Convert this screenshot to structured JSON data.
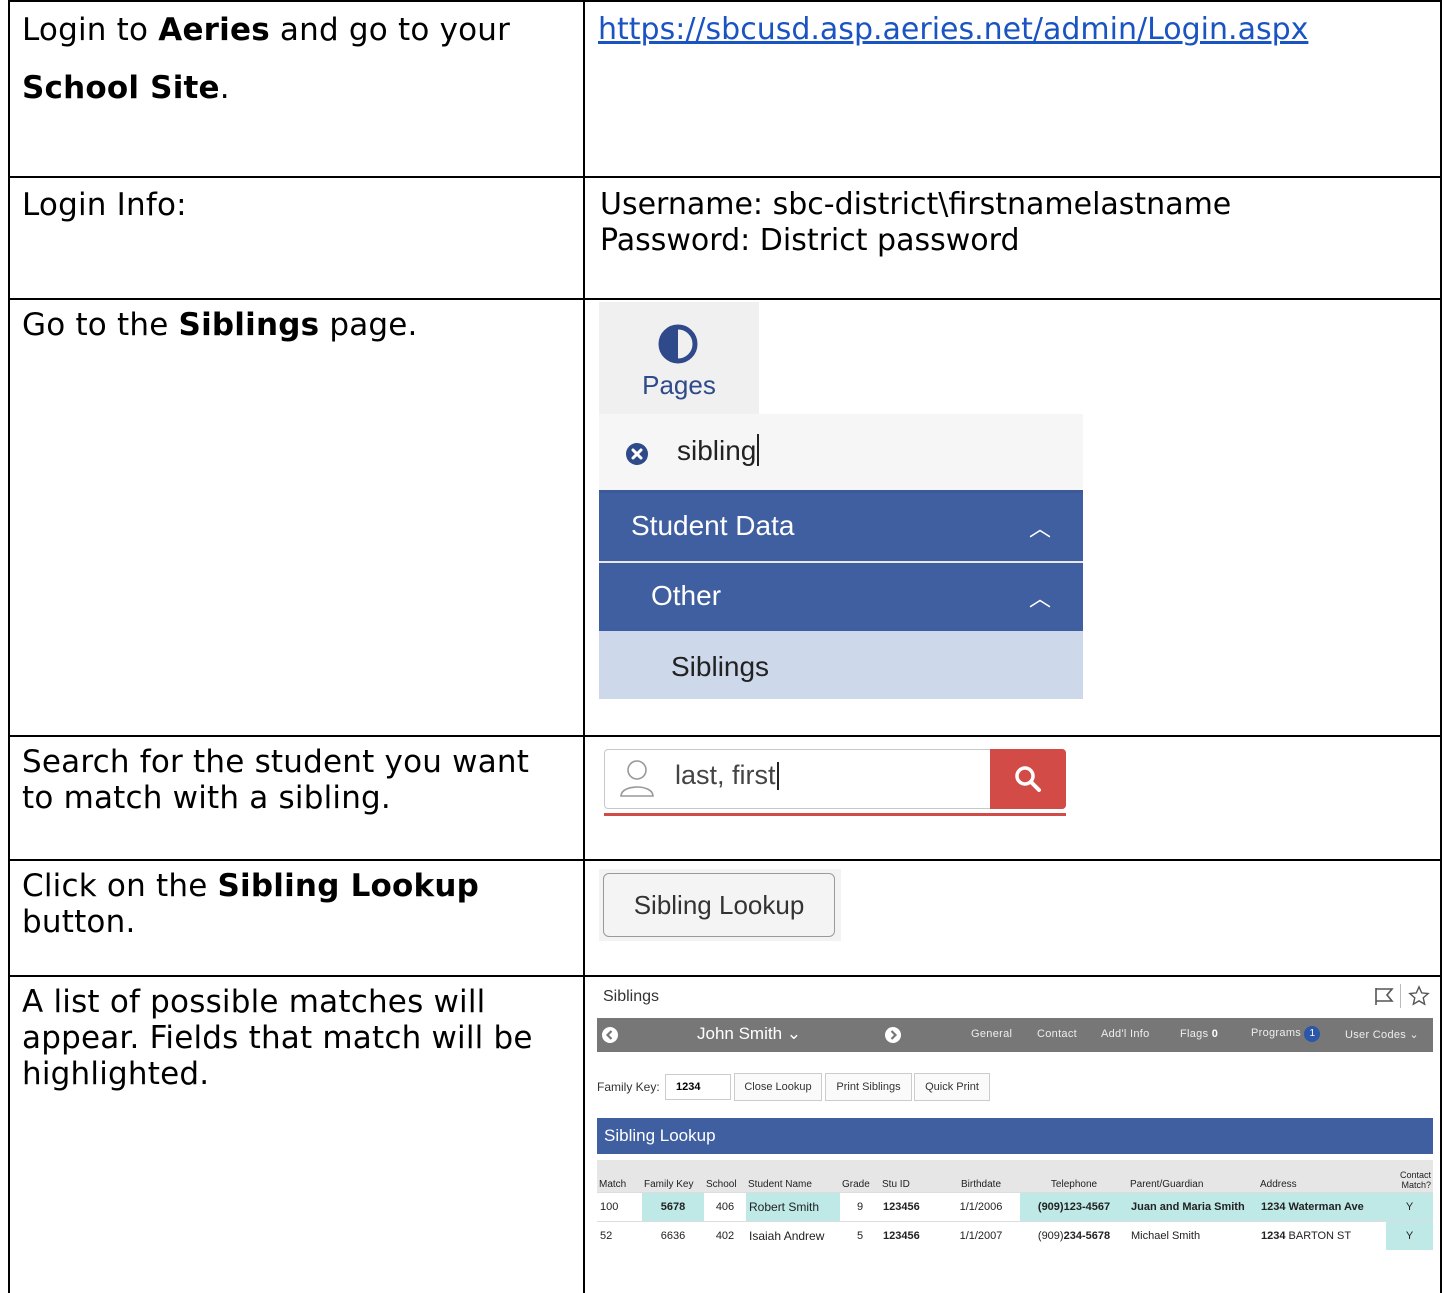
{
  "rows": [
    {
      "left_parts": [
        {
          "t": "Login to ",
          "b": false
        },
        {
          "t": "Aeries",
          "b": true
        },
        {
          "t": " and go to your",
          "b": false
        }
      ],
      "left_parts2": [
        {
          "t": "School Site",
          "b": true
        },
        {
          "t": ".",
          "b": false
        }
      ],
      "link": "https://sbcusd.asp.aeries.net/admin/Login.aspx"
    },
    {
      "left": "Login Info:",
      "login_lines": [
        "Username: sbc-district\\firstnamelastname",
        "Password: District password"
      ]
    },
    {
      "left_parts": [
        {
          "t": "Go to the ",
          "b": false
        },
        {
          "t": "Siblings",
          "b": true
        },
        {
          "t": " page.",
          "b": false
        }
      ]
    },
    {
      "left_line1": "Search for the student you want",
      "left_line2": "to match with a sibling."
    },
    {
      "left_parts": [
        {
          "t": "Click on the ",
          "b": false
        },
        {
          "t": "Sibling Lookup",
          "b": true
        }
      ],
      "left_line2": "button."
    },
    {
      "left_line1": "A list of possible matches will",
      "left_line2": "appear. Fields that match will be",
      "left_line3": "highlighted."
    }
  ],
  "pages_menu": {
    "button_label": "Pages",
    "search_value": "sibling",
    "section": "Student Data",
    "subsection": "Other",
    "item": "Siblings"
  },
  "student_search": {
    "placeholder": "last, first"
  },
  "sibling_button": {
    "label": "Sibling Lookup"
  },
  "siblings_page": {
    "title": "Siblings",
    "student_name": "John Smith ⌄",
    "nav_links": [
      "General",
      "Contact",
      "Add'l Info",
      "Flags",
      "Programs",
      "User Codes ⌄"
    ],
    "flags_count": "0",
    "programs_count": "1",
    "family_key_label": "Family Key:",
    "family_key_value": "1234",
    "buttons": [
      "Close Lookup",
      "Print Siblings",
      "Quick Print"
    ],
    "section_title": "Sibling Lookup",
    "columns": [
      "Match",
      "Family Key",
      "School",
      "Student Name",
      "Grade",
      "Stu ID",
      "Birthdate",
      "Telephone",
      "Parent/Guardian",
      "Address",
      "Contact Match?"
    ],
    "table_rows": [
      {
        "match": "100",
        "family_key": "5678",
        "school": "406",
        "name": "Robert Smith",
        "grade": "9",
        "stu_id": "123456",
        "birthdate": "1/1/2006",
        "phone_prefix": "(909)",
        "phone_rest": "123-4567",
        "parent": "Juan and Maria Smith",
        "address_bold": "1234 Waterman Ave",
        "address_rest": "",
        "contact": "Y"
      },
      {
        "match": "52",
        "family_key": "6636",
        "school": "402",
        "name": "Isaiah Andrew",
        "grade": "5",
        "stu_id": "123456",
        "birthdate": "1/1/2007",
        "phone_prefix": "(909)",
        "phone_rest": "234-5678",
        "parent": "Michael Smith",
        "address_bold": "1234",
        "address_rest": " BARTON ST",
        "contact": "Y"
      }
    ]
  },
  "colors": {
    "link": "#1a53c2",
    "menu_blue": "#3f5fa0",
    "search_red": "#d34b47",
    "highlight": "#bfe9e6"
  }
}
